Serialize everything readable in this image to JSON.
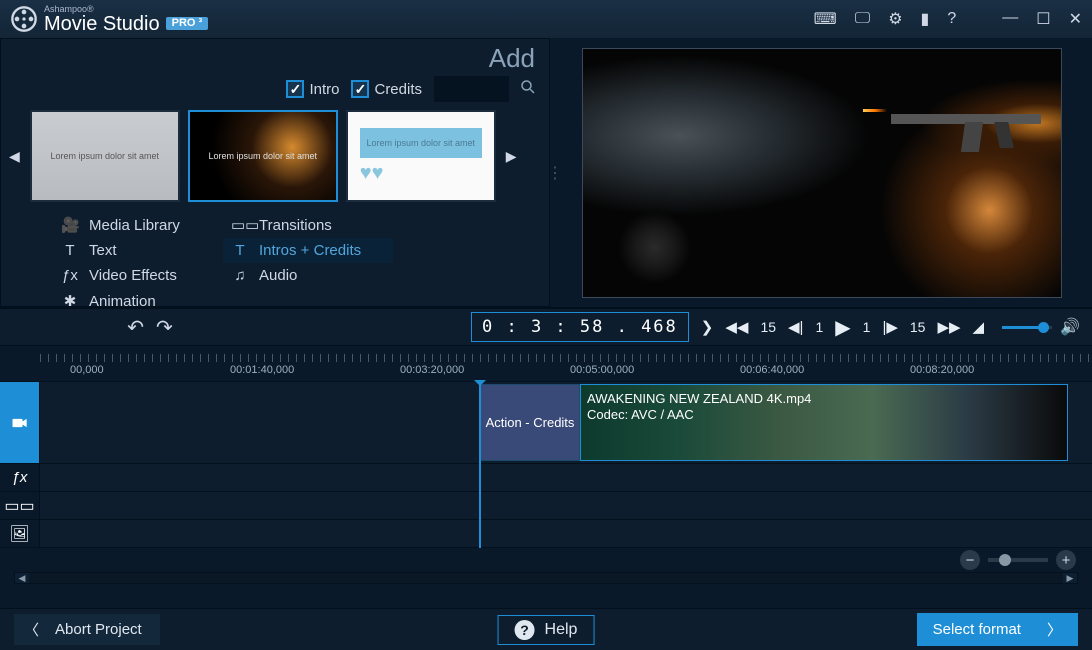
{
  "titlebar": {
    "brand_small": "Ashampoo®",
    "brand_main": "Movie Studio",
    "pro_badge": "PRO ³"
  },
  "left_panel": {
    "add_label": "Add",
    "filters": {
      "intro_label": "Intro",
      "credits_label": "Credits"
    },
    "thumbs": {
      "placeholder1": "Lorem ipsum dolor sit amet",
      "placeholder2": "Lorem ipsum dolor sit amet",
      "placeholder3": "Lorem ipsum dolor sit amet"
    },
    "categories": [
      {
        "icon": "🎥",
        "label": "Media Library"
      },
      {
        "icon": "▭▭",
        "label": "Transitions"
      },
      {
        "icon": "T",
        "label": "Text"
      },
      {
        "icon": "T",
        "label": "Intros + Credits"
      },
      {
        "icon": "ƒx",
        "label": "Video Effects"
      },
      {
        "icon": "♫",
        "label": "Audio"
      },
      {
        "icon": "✱",
        "label": "Animation"
      }
    ]
  },
  "transport": {
    "timecode": "0 : 3 : 58 . 468",
    "skip_small": "1",
    "skip_large": "15"
  },
  "ruler": {
    "marks": [
      "00,000",
      "00:01:40,000",
      "00:03:20,000",
      "00:05:00,000",
      "00:06:40,000",
      "00:08:20,000"
    ]
  },
  "clips": {
    "credits_label": "Action - Credits",
    "video_title": "AWAKENING   NEW ZEALAND 4K.mp4",
    "video_codec": "Codec: AVC / AAC"
  },
  "footer": {
    "abort_label": "Abort Project",
    "help_label": "Help",
    "select_label": "Select format"
  }
}
